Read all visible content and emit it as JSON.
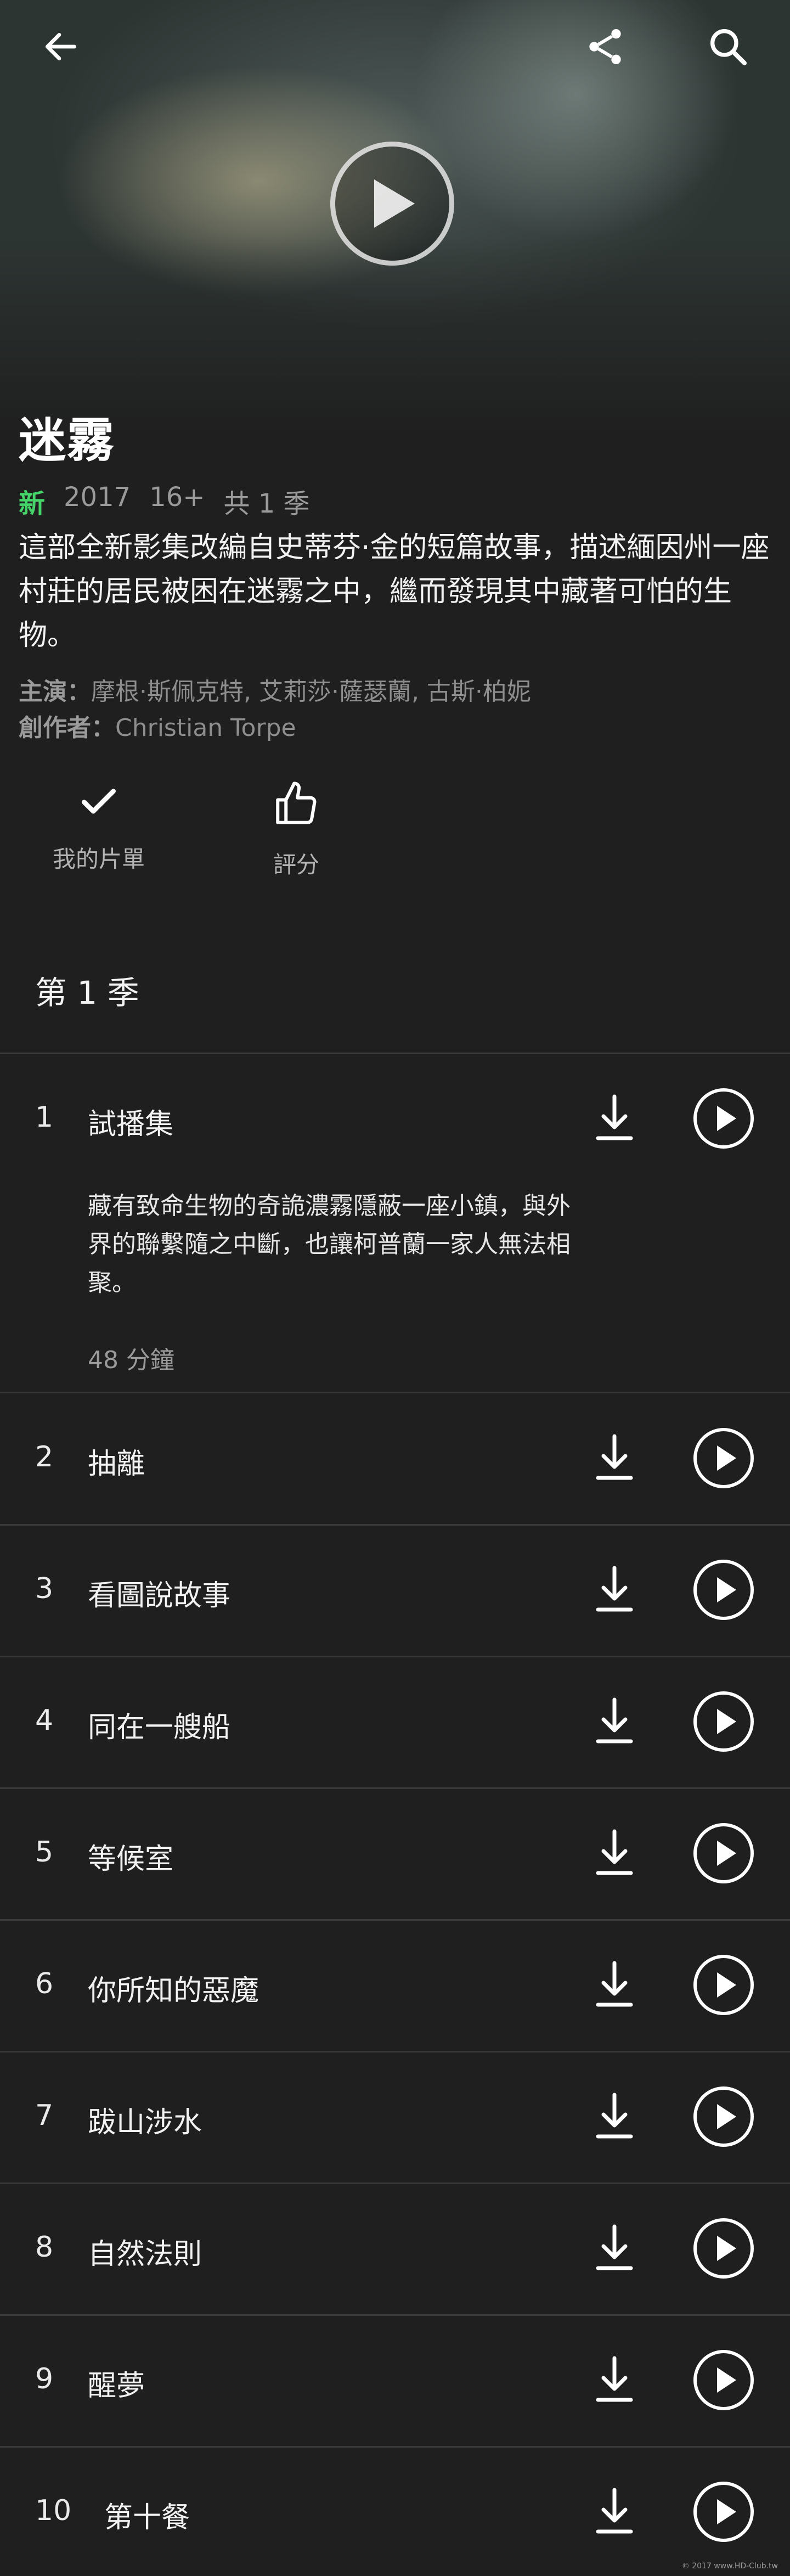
{
  "show": {
    "title": "迷霧",
    "badge": "新",
    "year": "2017",
    "rating": "16+",
    "seasons": "共 1 季",
    "description": "這部全新影集改編自史蒂芬·金的短篇故事，描述緬因州一座村莊的居民被困在迷霧之中，繼而發現其中藏著可怕的生物。",
    "cast_label": "主演：",
    "cast": "摩根·斯佩克特, 艾莉莎·薩瑟蘭, 古斯·柏妮",
    "creator_label": "創作者：",
    "creator": "Christian Torpe"
  },
  "actions": {
    "my_list_label": "我的片單",
    "rate_label": "評分"
  },
  "season_title": "第 1 季",
  "episodes": [
    {
      "num": "1",
      "title": "試播集",
      "description": "藏有致命生物的奇詭濃霧隱蔽一座小鎮，與外界的聯繫隨之中斷，也讓柯普蘭一家人無法相聚。",
      "duration": "48 分鐘"
    },
    {
      "num": "2",
      "title": "抽離"
    },
    {
      "num": "3",
      "title": "看圖說故事"
    },
    {
      "num": "4",
      "title": "同在一艘船"
    },
    {
      "num": "5",
      "title": "等候室"
    },
    {
      "num": "6",
      "title": "你所知的惡魔"
    },
    {
      "num": "7",
      "title": "跋山涉水"
    },
    {
      "num": "8",
      "title": "自然法則"
    },
    {
      "num": "9",
      "title": "醒夢"
    },
    {
      "num": "10",
      "title": "第十餐"
    }
  ],
  "icons": {
    "back": "arrow-left-icon",
    "share": "share-icon",
    "search": "search-icon",
    "play": "play-icon",
    "download": "download-icon",
    "check": "check-icon",
    "thumb": "thumbs-up-icon"
  },
  "colors": {
    "background": "#1f1f1f",
    "accent_new": "#46d369",
    "muted_text": "#9a9a9a"
  },
  "watermark": "© 2017 www.HD-Club.tw"
}
